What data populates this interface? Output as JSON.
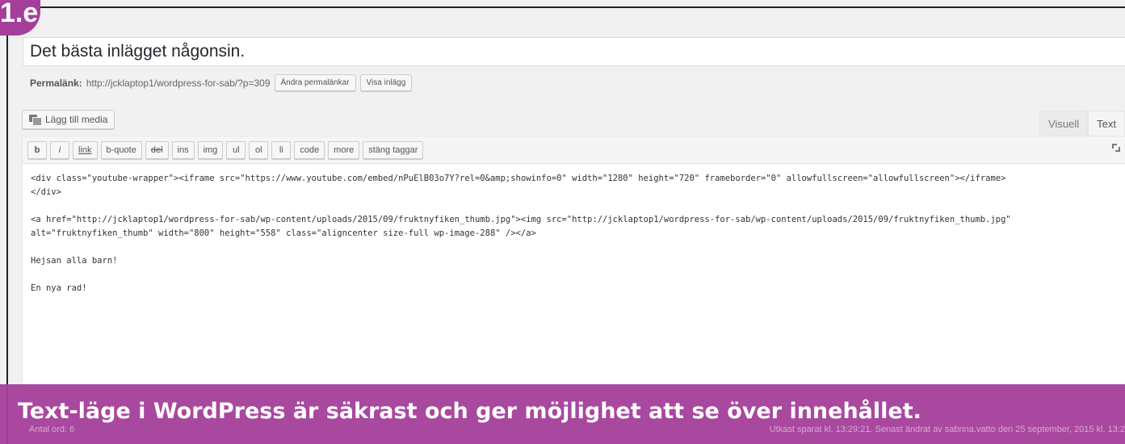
{
  "badge": {
    "text": "1.e"
  },
  "post": {
    "title": "Det bästa inlägget någonsin."
  },
  "permalink": {
    "label": "Permalänk:",
    "url": "http://jcklaptop1/wordpress-for-sab/?p=309",
    "edit_button": "Ändra permalänkar",
    "view_button": "Visa inlägg"
  },
  "media": {
    "add_media_label": "Lägg till media"
  },
  "tabs": {
    "visual": "Visuell",
    "text": "Text"
  },
  "quicktags": [
    "b",
    "i",
    "link",
    "b-quote",
    "del",
    "ins",
    "img",
    "ul",
    "ol",
    "li",
    "code",
    "more",
    "stäng taggar"
  ],
  "content": {
    "lines": [
      "<div class=\"youtube-wrapper\"><iframe src=\"https://www.youtube.com/embed/nPuElB03o7Y?rel=0&amp;showinfo=0\" width=\"1280\" height=\"720\" frameborder=\"0\" allowfullscreen=\"allowfullscreen\"></iframe>",
      "</div>",
      "",
      "<a href=\"http://jcklaptop1/wordpress-for-sab/wp-content/uploads/2015/09/fruktnyfiken_thumb.jpg\"><img src=\"http://jcklaptop1/wordpress-for-sab/wp-content/uploads/2015/09/fruktnyfiken_thumb.jpg\"",
      "alt=\"fruktnyfiken_thumb\" width=\"800\" height=\"558\" class=\"aligncenter size-full wp-image-288\" /></a>",
      "",
      "Hejsan alla barn!",
      "",
      "En nya rad!"
    ]
  },
  "status": {
    "word_count": "Antal ord: 6",
    "saved": "Utkast sparat kl. 13:29:21. Senast ändrat av sabrina.vatto den 25 september, 2015 kl. 13:2"
  },
  "caption": "Text-läge i WordPress är säkrast och ger möjlighet att se över innehållet."
}
